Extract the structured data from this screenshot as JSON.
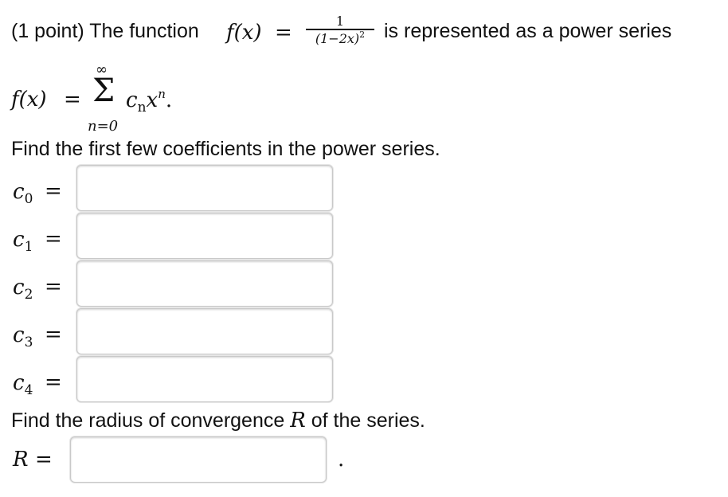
{
  "problem": {
    "intro": "(1 point) The function",
    "fx_label": "f(x)",
    "equals": "=",
    "fraction_numerator": "1",
    "fraction_denominator": "(1−2x)",
    "fraction_denominator_exponent": "2",
    "intro_suffix": "is represented as a power series",
    "series_lhs": "f(x)",
    "series_sum_upper": "∞",
    "series_sum_symbol": "Σ",
    "series_sum_lower": "n=0",
    "series_term_c": "c",
    "series_term_sub": "n",
    "series_term_x": "x",
    "series_term_exp": "n",
    "series_period": ".",
    "instruction_coefficients": "Find the first few coefficients in the power series.",
    "instruction_radius_pre": "Find the radius of convergence",
    "instruction_radius_var": "R",
    "instruction_radius_post": "of the series."
  },
  "coefficients": [
    {
      "symbol": "c",
      "index": "0",
      "equals": "=",
      "value": ""
    },
    {
      "symbol": "c",
      "index": "1",
      "equals": "=",
      "value": ""
    },
    {
      "symbol": "c",
      "index": "2",
      "equals": "=",
      "value": ""
    },
    {
      "symbol": "c",
      "index": "3",
      "equals": "=",
      "value": ""
    },
    {
      "symbol": "c",
      "index": "4",
      "equals": "=",
      "value": ""
    }
  ],
  "radius": {
    "symbol": "R",
    "equals": "=",
    "value": "",
    "trailing": "."
  }
}
